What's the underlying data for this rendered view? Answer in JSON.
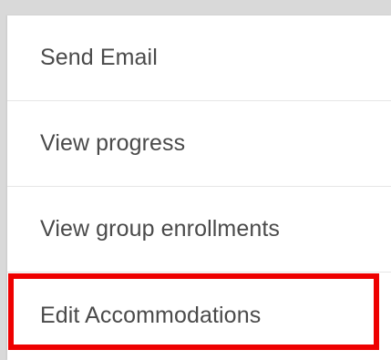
{
  "menu": {
    "items": [
      {
        "label": "Send Email"
      },
      {
        "label": "View progress"
      },
      {
        "label": "View group enrollments"
      },
      {
        "label": "Edit Accommodations"
      }
    ]
  },
  "highlight": {
    "color": "#ee0000",
    "target": "Edit Accommodations"
  }
}
